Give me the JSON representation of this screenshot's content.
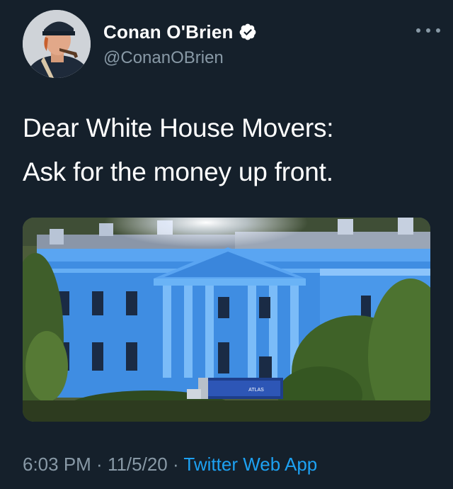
{
  "author": {
    "display_name": "Conan O'Brien",
    "handle": "@ConanOBrien",
    "verified": true,
    "avatar_icon": "profile-photo"
  },
  "tweet": {
    "lines": [
      "Dear White House Movers:",
      "Ask for the money up front."
    ]
  },
  "media": {
    "truck_text": "ATLAS"
  },
  "meta": {
    "time": "6:03 PM",
    "separator": " · ",
    "date": "11/5/20",
    "source": "Twitter Web App"
  },
  "colors": {
    "background": "#15202b",
    "secondary_text": "#8899a6",
    "accent": "#1da1f2"
  }
}
